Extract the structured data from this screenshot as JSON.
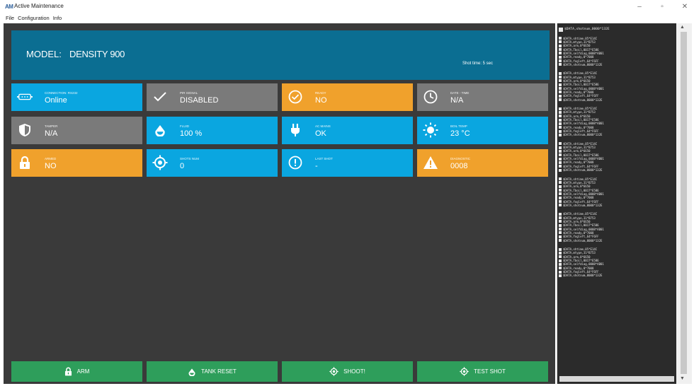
{
  "window": {
    "app_icon_text": "AM",
    "title": "Active Maintenance",
    "controls": [
      "–",
      "▫",
      "✕"
    ]
  },
  "menu": [
    "File",
    "Configuration",
    "Info"
  ],
  "header": {
    "model_label": "MODEL:",
    "model_value": "DENSITY 900",
    "shot_time": "Shot time: 5 sec"
  },
  "tiles": [
    {
      "label": "CONNECTION: RS232",
      "value": "Online",
      "color": "#0aa6e0",
      "icon": "serial-port-icon"
    },
    {
      "label": "PIR SIGNAL",
      "value": "DISABLED",
      "color": "#7a7a7a",
      "icon": "checkmark-icon"
    },
    {
      "label": "READY",
      "value": "NO",
      "color": "#f0a12c",
      "icon": "check-circle-icon"
    },
    {
      "label": "DATE - TIME",
      "value": "N/A",
      "color": "#7a7a7a",
      "icon": "clock-icon"
    },
    {
      "label": "TAMPER",
      "value": "N/A",
      "color": "#7a7a7a",
      "icon": "shield-icon"
    },
    {
      "label": "FLUID",
      "value": "100 %",
      "color": "#0aa6e0",
      "icon": "drop-icon"
    },
    {
      "label": "AC MAINS",
      "value": "OK",
      "color": "#0aa6e0",
      "icon": "plug-icon"
    },
    {
      "label": "BOIL TEMP",
      "value": "23 °C",
      "color": "#0aa6e0",
      "icon": "sun-icon"
    },
    {
      "label": "ARMED",
      "value": "NO",
      "color": "#f0a12c",
      "icon": "lock-icon"
    },
    {
      "label": "SHOTS NUM",
      "value": "0",
      "color": "#0aa6e0",
      "icon": "target-icon"
    },
    {
      "label": "LAST SHOT",
      "value": "-",
      "color": "#0aa6e0",
      "icon": "info-circle-icon"
    },
    {
      "label": "DIAGNOSTIC",
      "value": "0008",
      "color": "#f0a12c",
      "icon": "warning-icon"
    }
  ],
  "buttons": [
    {
      "label": "ARM",
      "icon": "lock-icon"
    },
    {
      "label": "TANK RESET",
      "icon": "drop-icon"
    },
    {
      "label": "SHOOT!",
      "icon": "target-icon"
    },
    {
      "label": "TEST SHOT",
      "icon": "target-icon"
    }
  ],
  "log": {
    "first": "$DATA,shotnum,0000*132E",
    "group": [
      "$DATA,shtime,05*E14C",
      "$DATA,mtype,31*B753",
      "$DATA,arm,0*6650",
      "$DATA,Tboil,0017*E586",
      "$DATA,selfdiag,0008*AB01",
      "$DATA,ready,0*7008",
      "$DATA,fogleft,64*F6FF",
      "$DATA,shotnum,0000*132E"
    ]
  }
}
